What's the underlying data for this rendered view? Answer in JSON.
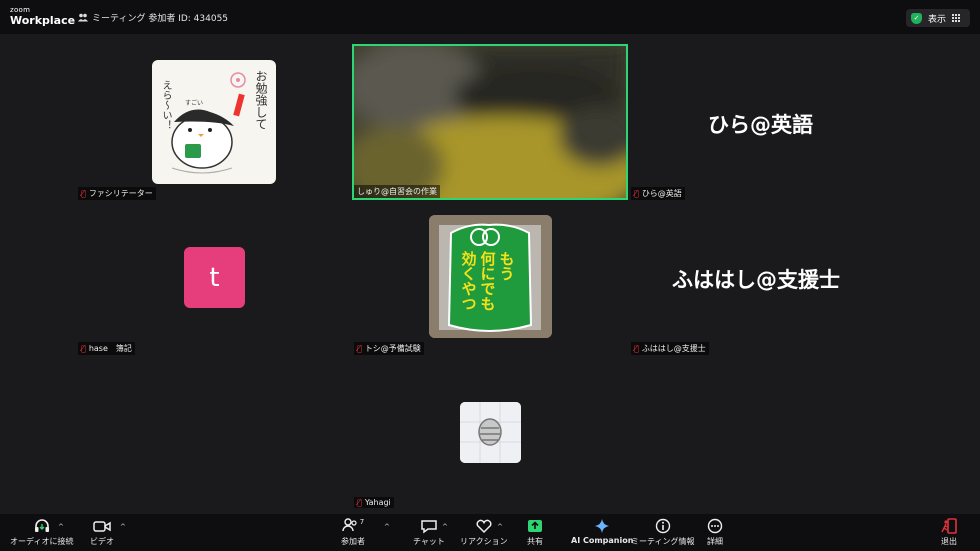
{
  "app": {
    "logo_top": "zoom",
    "logo_bottom": "Workplace"
  },
  "meeting": {
    "info": "ミーティング 参加者 ID: 434055",
    "show_label": "表示"
  },
  "participants": {
    "facilitator": "ファシリテーター",
    "shuri": "しゅり@自習会の作業",
    "hira_tag": "ひら@英語",
    "hira_big": "ひら@英語",
    "hase": "hase　簿記",
    "hase_initial": "t",
    "toshi": "トシ@予備試験",
    "fuhashi_tag": "ふははし@支援士",
    "fuhashi_big": "ふははし@支援士",
    "yahagi": "Yahagi"
  },
  "drawing": {
    "right_text": "お勉強して",
    "left_text": "えら〜い！",
    "cup_text": "すごい"
  },
  "omamori": {
    "col1": "効くやつ",
    "col2": "何にでも",
    "col3": "もう"
  },
  "toolbar": {
    "audio": "オーディオに接続",
    "video": "ビデオ",
    "participants": "参加者",
    "participant_count": "7",
    "chat": "チャット",
    "reactions": "リアクション",
    "share": "共有",
    "ai": "AI Companion",
    "info": "ミーティング情報",
    "more": "詳細",
    "leave": "退出"
  },
  "colors": {
    "accent_green": "#2ed573",
    "avatar_pink": "#e63e7c",
    "mute_red": "#e0313a",
    "omamori_green": "#1f9a3c",
    "omamori_text": "#f4e21a"
  }
}
